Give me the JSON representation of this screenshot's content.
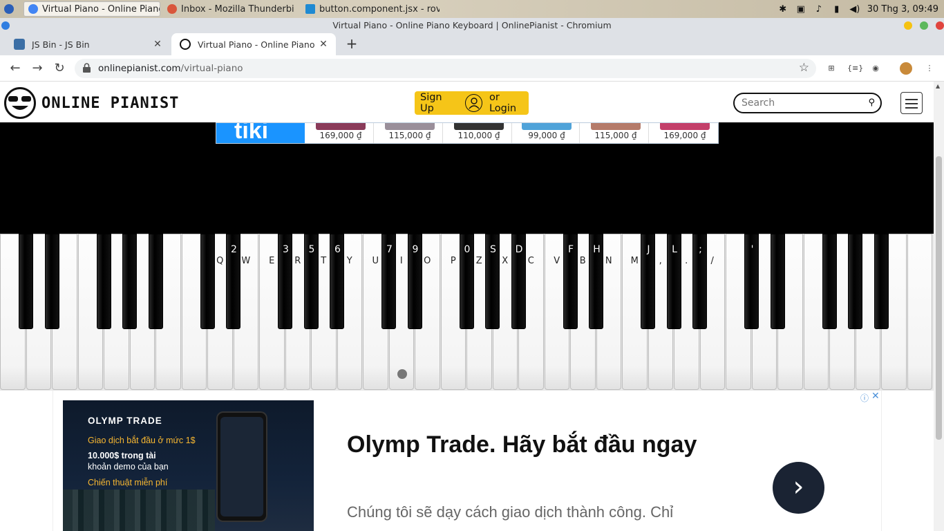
{
  "os": {
    "tasks": [
      {
        "label": "Virtual Piano - Online Piano ...",
        "active": true
      },
      {
        "label": "Inbox - Mozilla Thunderbird",
        "active": false
      },
      {
        "label": "button.component.jsx - rove...",
        "active": false
      }
    ],
    "clock": "30 Thg 3, 09:49"
  },
  "window": {
    "title": "Virtual Piano - Online Piano Keyboard | OnlinePianist - Chromium"
  },
  "tabs": [
    {
      "label": "JS Bin - JS Bin",
      "close": "✕"
    },
    {
      "label": "Virtual Piano - Online Piano Keyboard",
      "close": "✕"
    }
  ],
  "new_tab": "+",
  "address": {
    "host": "onlinepianist.com",
    "path": "/virtual-piano"
  },
  "site": {
    "logo_text": "ONLINE PIANIST",
    "signup_label": "Sign Up",
    "login_label": "or Login",
    "search_placeholder": "Search"
  },
  "banner_ad": {
    "brand": "tiki",
    "prices": [
      "169,000 ₫",
      "115,000 ₫",
      "110,000 ₫",
      "99,000 ₫",
      "115,000 ₫",
      "169,000 ₫"
    ]
  },
  "piano": {
    "white_labels": [
      "",
      "",
      "",
      "",
      "",
      "",
      "",
      "",
      "Q",
      "W",
      "E",
      "R",
      "T",
      "Y",
      "U",
      "I",
      "O",
      "P",
      "Z",
      "X",
      "C",
      "V",
      "B",
      "N",
      "M",
      ",",
      ".",
      "/",
      "",
      "",
      "",
      "",
      "",
      "",
      "",
      ""
    ],
    "black_labels": [
      "",
      "",
      "",
      "",
      "",
      "",
      "2",
      "3",
      "5",
      "6",
      "7",
      "9",
      "0",
      "S",
      "D",
      "F",
      "H",
      "J",
      "L",
      ";",
      "'",
      "",
      "",
      "",
      "",
      ""
    ]
  },
  "bottom_ad": {
    "brand": "OLYMP TRADE",
    "line1": "Giao dịch bắt đầu ở mức 1$",
    "line2": "10.000$ trong tài",
    "line3": "khoản demo của bạn",
    "line4": "Chiến thuật miễn phí",
    "title": "Olymp Trade. Hãy bắt đầu ngay",
    "body": "Chúng tôi sẽ dạy cách giao dịch thành công. Chỉ",
    "info": "ⓘ",
    "close": "✕"
  }
}
